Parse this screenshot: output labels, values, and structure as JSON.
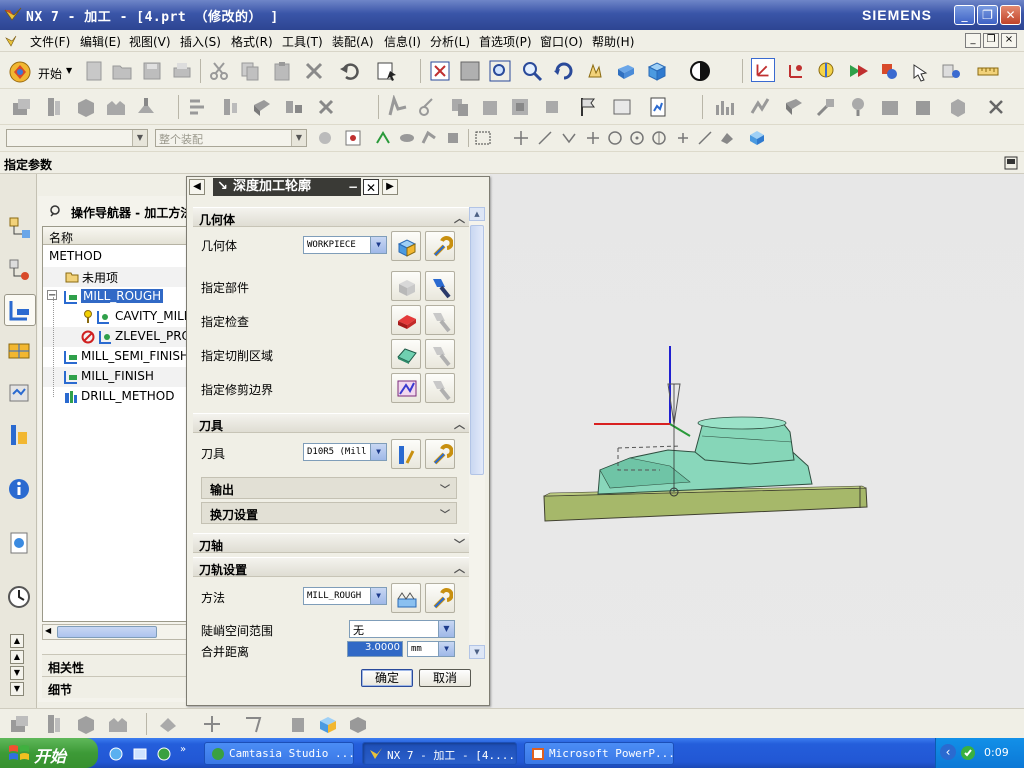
{
  "window": {
    "title": "NX 7 - 加工 - [4.prt （修改的） ]",
    "brand": "SIEMENS",
    "buttons": [
      "_",
      "❐",
      "✕"
    ]
  },
  "menubar": {
    "items": [
      "文件(F)",
      "编辑(E)",
      "视图(V)",
      "插入(S)",
      "格式(R)",
      "工具(T)",
      "装配(A)",
      "信息(I)",
      "分析(L)",
      "首选项(P)",
      "窗口(O)",
      "帮助(H)"
    ]
  },
  "toolbar": {
    "start_label": "开始",
    "selection_filter": "",
    "assembly_scope": "整个装配"
  },
  "cue_line": "指定参数",
  "navigator": {
    "title": "操作导航器 - 加工方法",
    "column_header": "名称",
    "rows": [
      {
        "label": "METHOD",
        "level": 0,
        "icon": "none"
      },
      {
        "label": "未用项",
        "level": 1,
        "icon": "folder-icon"
      },
      {
        "label": "MILL_ROUGH",
        "level": 1,
        "icon": "method-icon",
        "selected": true
      },
      {
        "label": "CAVITY_MILL",
        "level": 2,
        "icon": "operation-ok-icon"
      },
      {
        "label": "ZLEVEL_PROFILE",
        "level": 2,
        "icon": "operation-regen-icon"
      },
      {
        "label": "MILL_SEMI_FINISH",
        "level": 1,
        "icon": "method-icon"
      },
      {
        "label": "MILL_FINISH",
        "level": 1,
        "icon": "method-icon"
      },
      {
        "label": "DRILL_METHOD",
        "level": 1,
        "icon": "drill-icon"
      }
    ],
    "sections": [
      "相关性",
      "细节"
    ]
  },
  "dialog": {
    "title": "深度加工轮廓",
    "groups": {
      "geometry": {
        "title": "几何体",
        "geometry_label": "几何体",
        "geometry_value": "WORKPIECE",
        "specify_part": "指定部件",
        "specify_check": "指定检查",
        "specify_cut_area": "指定切削区域",
        "specify_trim": "指定修剪边界"
      },
      "tool": {
        "title": "刀具",
        "tool_label": "刀具",
        "tool_value": "D10R5 (Mill",
        "output": "输出",
        "tool_change": "换刀设置"
      },
      "axis": {
        "title": "刀轴"
      },
      "path": {
        "title": "刀轨设置",
        "method_label": "方法",
        "method_value": "MILL_ROUGH",
        "steep_label": "陡峭空间范围",
        "steep_value": "无",
        "merge_label": "合并距离",
        "merge_value": "3.0000",
        "merge_unit": "mm"
      }
    },
    "ok": "确定",
    "cancel": "取消"
  },
  "taskbar": {
    "start": "开始",
    "tasks": [
      "Camtasia Studio ...",
      "NX 7 - 加工 - [4....",
      "Microsoft PowerP..."
    ],
    "clock": "0:09"
  },
  "colors": {
    "title_blue": "#3a55a8",
    "selection": "#3169c6",
    "part_green": "#7fd0b0",
    "base_green": "#a6b86a",
    "axis_red": "#d82020",
    "axis_blue": "#2020d0",
    "taskbar": "#245edb"
  }
}
